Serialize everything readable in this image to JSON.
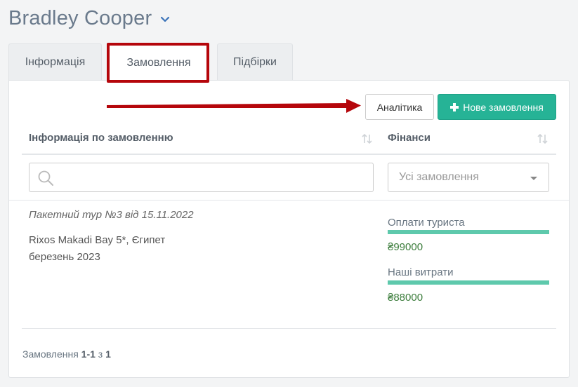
{
  "header": {
    "user_name": "Bradley Cooper",
    "dropdown_icon": "chevron-down-icon"
  },
  "tabs": [
    {
      "label": "Інформація",
      "active": false
    },
    {
      "label": "Замовлення",
      "active": true
    },
    {
      "label": "Підбірки",
      "active": false
    }
  ],
  "toolbar": {
    "analytics_label": "Аналітика",
    "new_order_label": "Нове замовлення"
  },
  "columns": {
    "info_header": "Інформація по замовленню",
    "finance_header": "Фінанси"
  },
  "filters": {
    "search_placeholder": "",
    "select_value": "Усі замовлення"
  },
  "order": {
    "title": "Пакетний тур №3 від 15.11.2022",
    "hotel": "Rixos Makadi Bay 5*, Єгипет",
    "date": "березень 2023",
    "finance": {
      "tourist_payments_label": "Оплати туриста",
      "tourist_payments_fill": 1.0,
      "tourist_payments_value": "₴99000",
      "our_costs_label": "Наші витрати",
      "our_costs_fill": 1.0,
      "our_costs_value": "₴88000"
    }
  },
  "footer": {
    "prefix": "Замовлення",
    "range": "1-1",
    "of": "з",
    "total": "1"
  },
  "colors": {
    "accent_green": "#26b396",
    "progress_green": "#5ec9ac",
    "value_green": "#3c7d3c",
    "annotation_red": "#b5060b"
  }
}
